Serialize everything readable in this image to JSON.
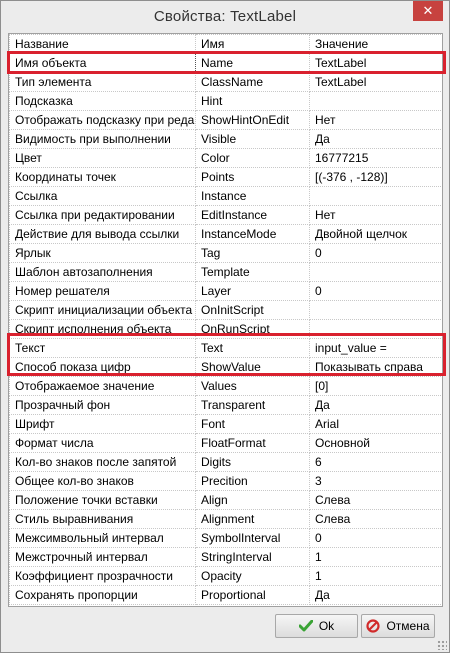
{
  "window": {
    "title": "Свойства:   TextLabel",
    "close_label": "✕"
  },
  "grid": {
    "headers": [
      "Название",
      "Имя",
      "Значение"
    ],
    "rows": [
      [
        "Имя объекта",
        "Name",
        "TextLabel"
      ],
      [
        "Тип элемента",
        "ClassName",
        "TextLabel"
      ],
      [
        "Подсказка",
        "Hint",
        ""
      ],
      [
        "Отображать подсказку при редактировании",
        "ShowHintOnEdit",
        "Нет"
      ],
      [
        "Видимость при выполнении",
        "Visible",
        "Да"
      ],
      [
        "Цвет",
        "Color",
        "16777215"
      ],
      [
        "Координаты точек",
        "Points",
        "[(-376 , -128)]"
      ],
      [
        "Ссылка",
        "Instance",
        ""
      ],
      [
        "Ссылка при редактировании",
        "EditInstance",
        "Нет"
      ],
      [
        "Действие для вывода ссылки",
        "InstanceMode",
        "Двойной щелчок"
      ],
      [
        "Ярлык",
        "Tag",
        "0"
      ],
      [
        "Шаблон автозаполнения",
        "Template",
        ""
      ],
      [
        "Номер решателя",
        "Layer",
        "0"
      ],
      [
        "Скрипт инициализации объекта",
        "OnInitScript",
        ""
      ],
      [
        "Скрипт исполнения объекта",
        "OnRunScript",
        ""
      ],
      [
        "Текст",
        "Text",
        "input_value ="
      ],
      [
        "Способ показа цифр",
        "ShowValue",
        "Показывать справа"
      ],
      [
        "Отображаемое значение",
        "Values",
        "[0]"
      ],
      [
        "Прозрачный фон",
        "Transparent",
        "Да"
      ],
      [
        "Шрифт",
        "Font",
        "Arial"
      ],
      [
        "Формат числа",
        "FloatFormat",
        "Основной"
      ],
      [
        "Кол-во знаков после запятой",
        "Digits",
        "6"
      ],
      [
        "Общее кол-во знаков",
        "Precition",
        "3"
      ],
      [
        "Положение точки вставки",
        "Align",
        "Слева"
      ],
      [
        "Стиль выравнивания",
        "Alignment",
        "Слева"
      ],
      [
        "Межсимвольный интервал",
        "SymbolInterval",
        "0"
      ],
      [
        "Межстрочный интервал",
        "StringInterval",
        "1"
      ],
      [
        "Коэффициент прозрачности",
        "Opacity",
        "1"
      ],
      [
        "Сохранять пропорции",
        "Proportional",
        "Да"
      ]
    ]
  },
  "buttons": {
    "ok_label": "Ok",
    "cancel_label": "Отмена"
  },
  "colors": {
    "highlight": "#d9212e",
    "close": "#c7423f",
    "ok_check": "#3aa335",
    "cancel_icon": "#d12b2b"
  }
}
